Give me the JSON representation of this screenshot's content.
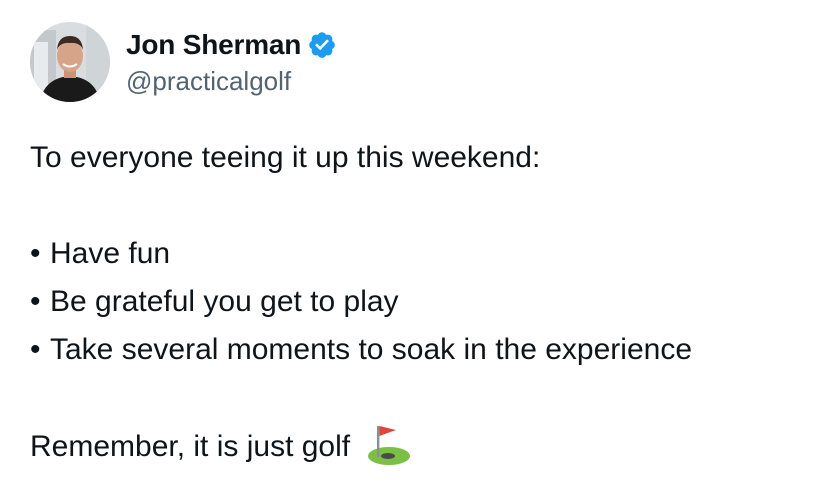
{
  "author": {
    "display_name": "Jon Sherman",
    "handle": "@practicalgolf",
    "verified_icon": "verified-badge-icon",
    "avatar_icon": "profile-photo"
  },
  "tweet": {
    "intro": "To everyone teeing it up this weekend:",
    "bullet_char": "•",
    "bullets": [
      "Have fun",
      "Be grateful you get to play",
      "Take several moments to soak in the experience"
    ],
    "closing": "Remember, it is just golf",
    "closing_emoji": "flag-in-hole-icon"
  },
  "colors": {
    "text": "#0f1419",
    "handle": "#536471",
    "verified": "#1d9bf0"
  }
}
